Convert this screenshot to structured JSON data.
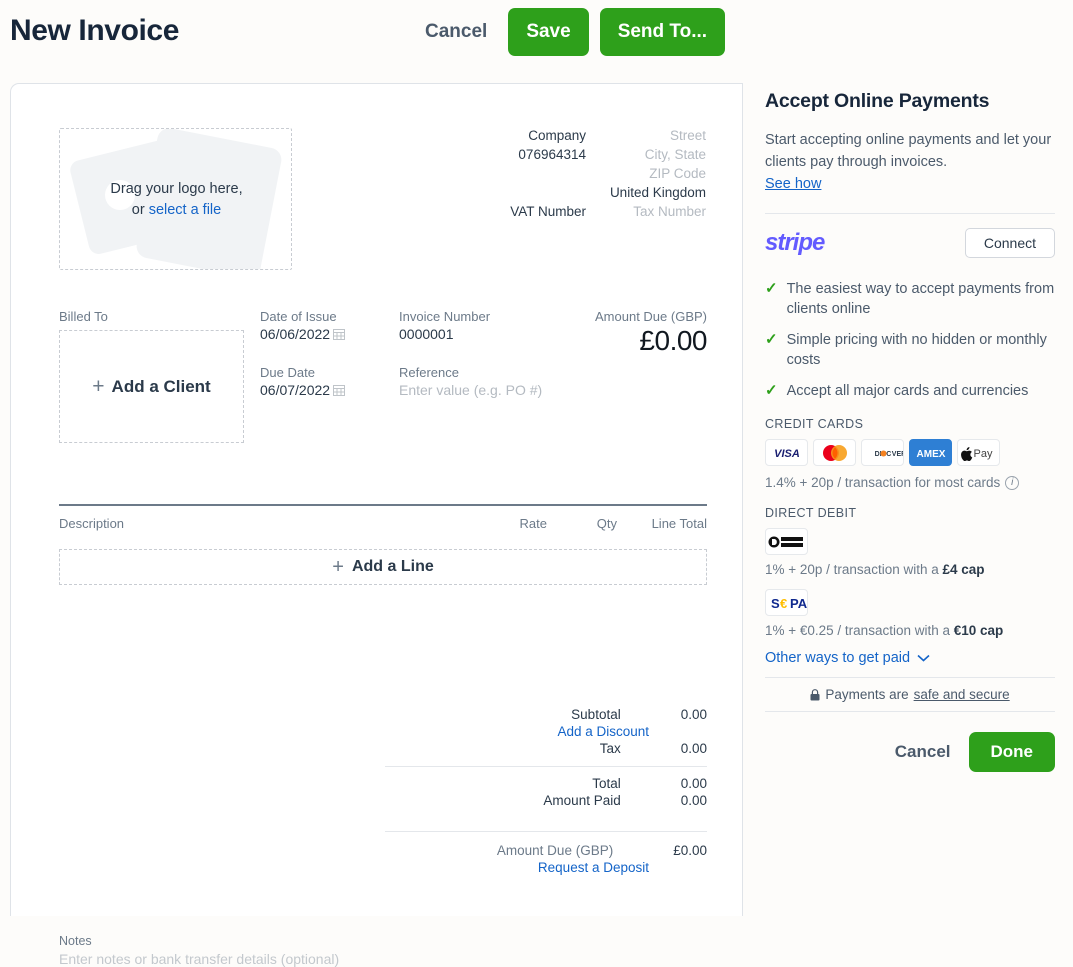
{
  "header": {
    "title": "New Invoice",
    "cancel_label": "Cancel",
    "save_label": "Save",
    "send_to_label": "Send To...",
    "accent_green": "#2EA01B"
  },
  "logo_dropzone": {
    "line1": "Drag your logo here,",
    "or_text": "or ",
    "select_link": "select a file"
  },
  "company": {
    "name": "Company",
    "phone": "076964314",
    "street_placeholder": "Street",
    "city_state_placeholder": "City, State",
    "zip_placeholder": "ZIP Code",
    "country": "United Kingdom",
    "vat_label": "VAT Number",
    "tax_placeholder": "Tax Number"
  },
  "meta": {
    "billed_to_label": "Billed To",
    "add_client_label": "Add a Client",
    "date_of_issue_label": "Date of Issue",
    "date_of_issue_value": "06/06/2022",
    "due_date_label": "Due Date",
    "due_date_value": "06/07/2022",
    "invoice_number_label": "Invoice Number",
    "invoice_number_value": "0000001",
    "reference_label": "Reference",
    "reference_placeholder": "Enter value (e.g. PO #)",
    "amount_due_label": "Amount Due (GBP)",
    "amount_due_value": "£0.00"
  },
  "items": {
    "col_description": "Description",
    "col_rate": "Rate",
    "col_qty": "Qty",
    "col_line_total": "Line Total",
    "add_line_label": "Add a Line"
  },
  "totals": {
    "subtotal_label": "Subtotal",
    "subtotal_value": "0.00",
    "add_discount_label": "Add a Discount",
    "tax_label": "Tax",
    "tax_value": "0.00",
    "total_label": "Total",
    "total_value": "0.00",
    "amount_paid_label": "Amount Paid",
    "amount_paid_value": "0.00",
    "amount_due_label": "Amount Due (GBP)",
    "amount_due_value": "£0.00",
    "request_deposit_label": "Request a Deposit"
  },
  "notes": {
    "label": "Notes",
    "placeholder": "Enter notes or bank transfer details (optional)"
  },
  "side": {
    "title": "Accept Online Payments",
    "description": "Start accepting online payments and let your clients pay through invoices.",
    "see_how_label": "See how",
    "stripe_logo_text": "stripe",
    "stripe_color": "#635BFF",
    "connect_label": "Connect",
    "benefits": [
      "The easiest way to accept payments from clients online",
      "Simple pricing with no hidden or monthly costs",
      "Accept all major cards and currencies"
    ],
    "credit_cards_label": "CREDIT CARDS",
    "card_brands": [
      "VISA",
      "Mastercard",
      "DISCOVER",
      "AMEX",
      "Apple Pay"
    ],
    "credit_card_fee": "1.4% + 20p / transaction for most cards",
    "direct_debit_label": "DIRECT DEBIT",
    "bacs_brand": "Direct Debit",
    "bacs_fee_prefix": "1% + 20p / transaction with a ",
    "bacs_fee_cap": "£4 cap",
    "sepa_brand": "SEPA",
    "sepa_fee_prefix": "1% + €0.25 / transaction with a ",
    "sepa_fee_cap": "€10 cap",
    "other_ways_label": "Other ways to get paid",
    "secure_prefix": "Payments are ",
    "secure_link": "safe and secure",
    "cancel_label": "Cancel",
    "done_label": "Done"
  }
}
